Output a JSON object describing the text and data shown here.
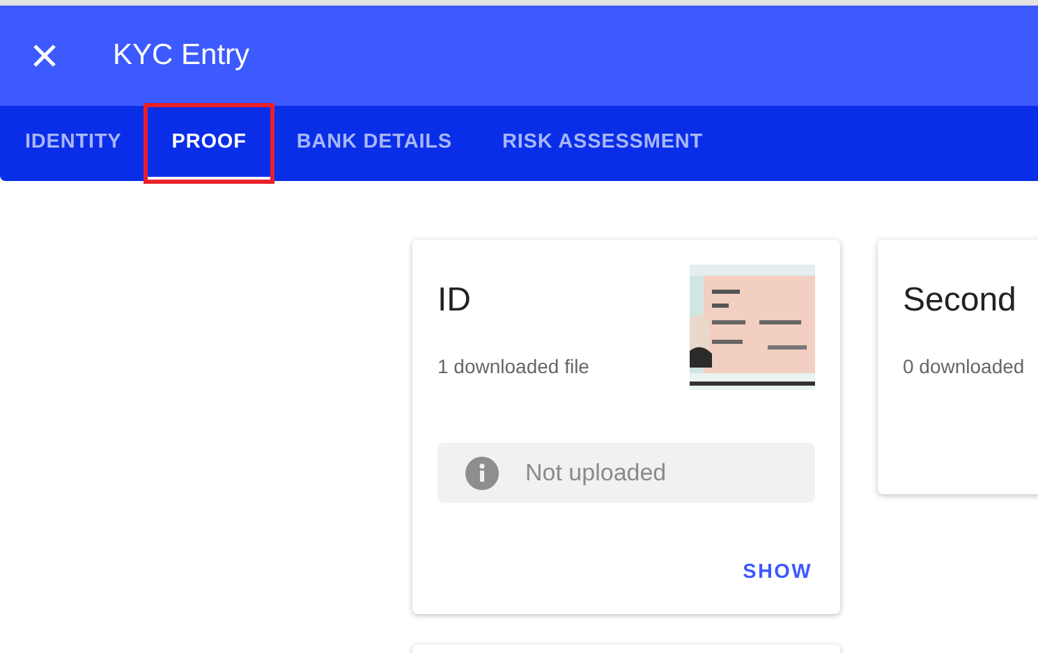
{
  "window": {
    "title": "KYC Entry"
  },
  "tabs": [
    {
      "label": "IDENTITY",
      "selected": false,
      "highlighted": false
    },
    {
      "label": "PROOF",
      "selected": true,
      "highlighted": true
    },
    {
      "label": "BANK DETAILS",
      "selected": false,
      "highlighted": false
    },
    {
      "label": "RISK ASSESSMENT",
      "selected": false,
      "highlighted": false
    }
  ],
  "cards": [
    {
      "kind": "document",
      "title": "ID",
      "subtitle": "1 downloaded file",
      "status": "Not uploaded",
      "action": "SHOW"
    },
    {
      "kind": "document",
      "title": "Second",
      "subtitle": "0 downloaded"
    },
    {
      "kind": "blank"
    }
  ]
}
